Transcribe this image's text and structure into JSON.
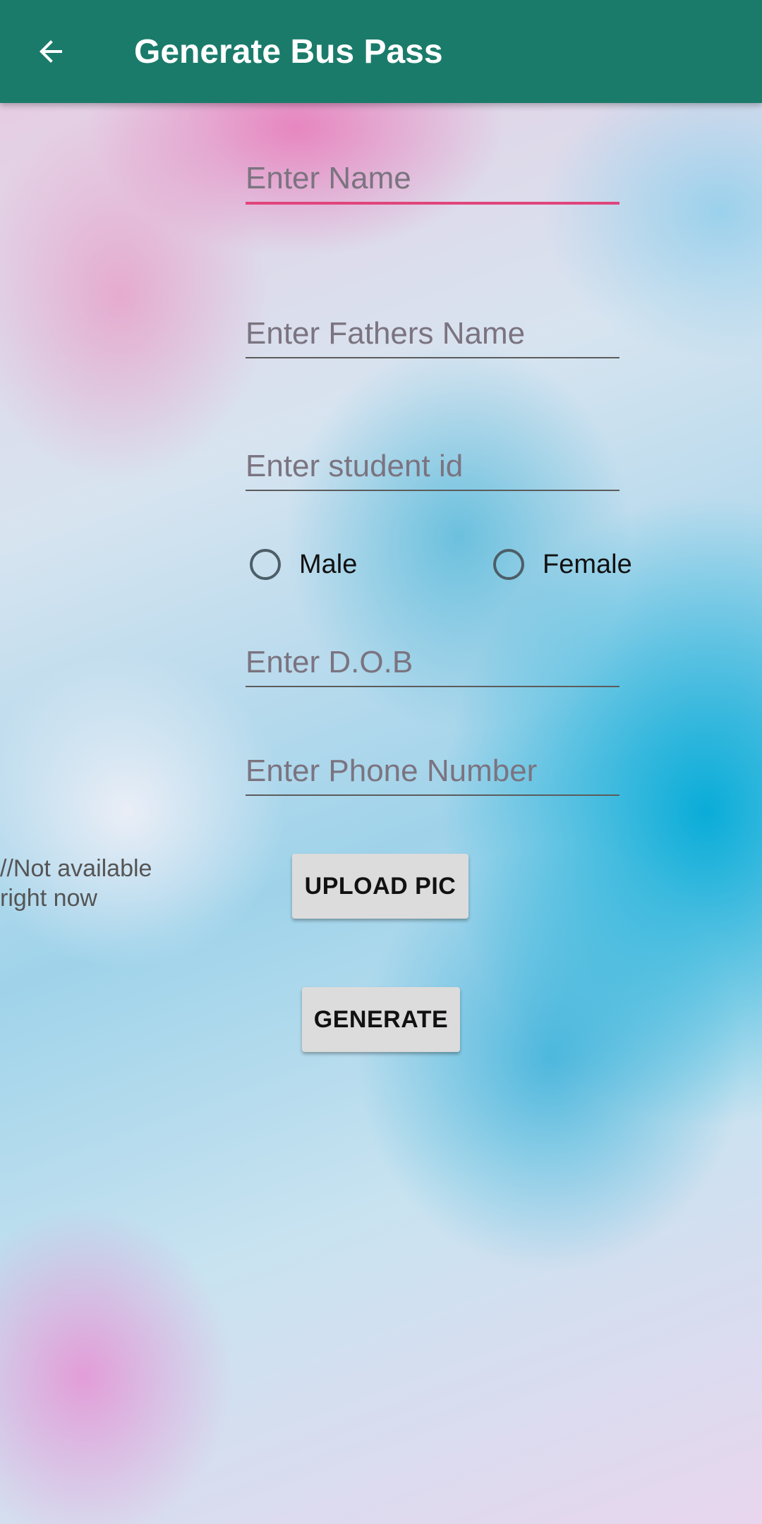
{
  "appbar": {
    "title": "Generate Bus Pass",
    "back_icon": "arrow-back-icon",
    "color": "#1b7b6b"
  },
  "form": {
    "name_placeholder": "Enter Name",
    "fathers_name_placeholder": "Enter Fathers Name",
    "student_id_placeholder": "Enter student id",
    "gender_options": [
      "Male",
      "Female"
    ],
    "dob_placeholder": "Enter D.O.B",
    "phone_placeholder": "Enter Phone Number",
    "focus_color": "#e0457b"
  },
  "note": "//Not available right now",
  "buttons": {
    "upload_label": "UPLOAD PIC",
    "generate_label": "GENERATE"
  }
}
